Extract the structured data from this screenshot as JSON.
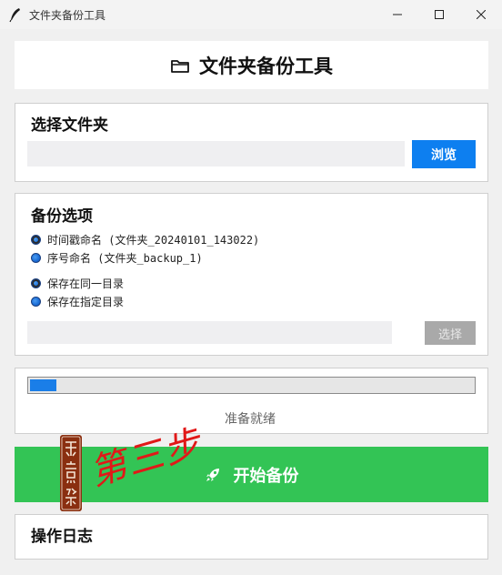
{
  "window": {
    "title": "文件夹备份工具",
    "icon": "feather-icon",
    "controls": [
      "minimize-icon",
      "maximize-icon",
      "close-icon"
    ]
  },
  "header": {
    "icon": "folder-icon",
    "title": "文件夹备份工具"
  },
  "select_folder": {
    "title": "选择文件夹",
    "path_value": "",
    "browse_label": "浏览"
  },
  "backup_options": {
    "title": "备份选项",
    "naming_options": [
      {
        "label": "时间戳命名 (文件夹_20240101_143022)",
        "selected": true
      },
      {
        "label": "序号命名 (文件夹_backup_1)",
        "selected": false
      }
    ],
    "location_options": [
      {
        "label": "保存在同一目录",
        "selected": true
      },
      {
        "label": "保存在指定目录",
        "selected": false
      }
    ],
    "target_value": "",
    "choose_label": "选择"
  },
  "progress": {
    "fraction": 0.06,
    "status": "准备就绪"
  },
  "start_button": {
    "icon": "rocket-icon",
    "label": "开始备份"
  },
  "log": {
    "title": "操作日志"
  },
  "overlay": {
    "seal_text": "乐意然",
    "stamp_text": "第三步"
  },
  "colors": {
    "accent_blue": "#0d7ff0",
    "start_green": "#33c455",
    "disabled_gray": "#a9a9a9",
    "stamp_red": "#e11818"
  }
}
